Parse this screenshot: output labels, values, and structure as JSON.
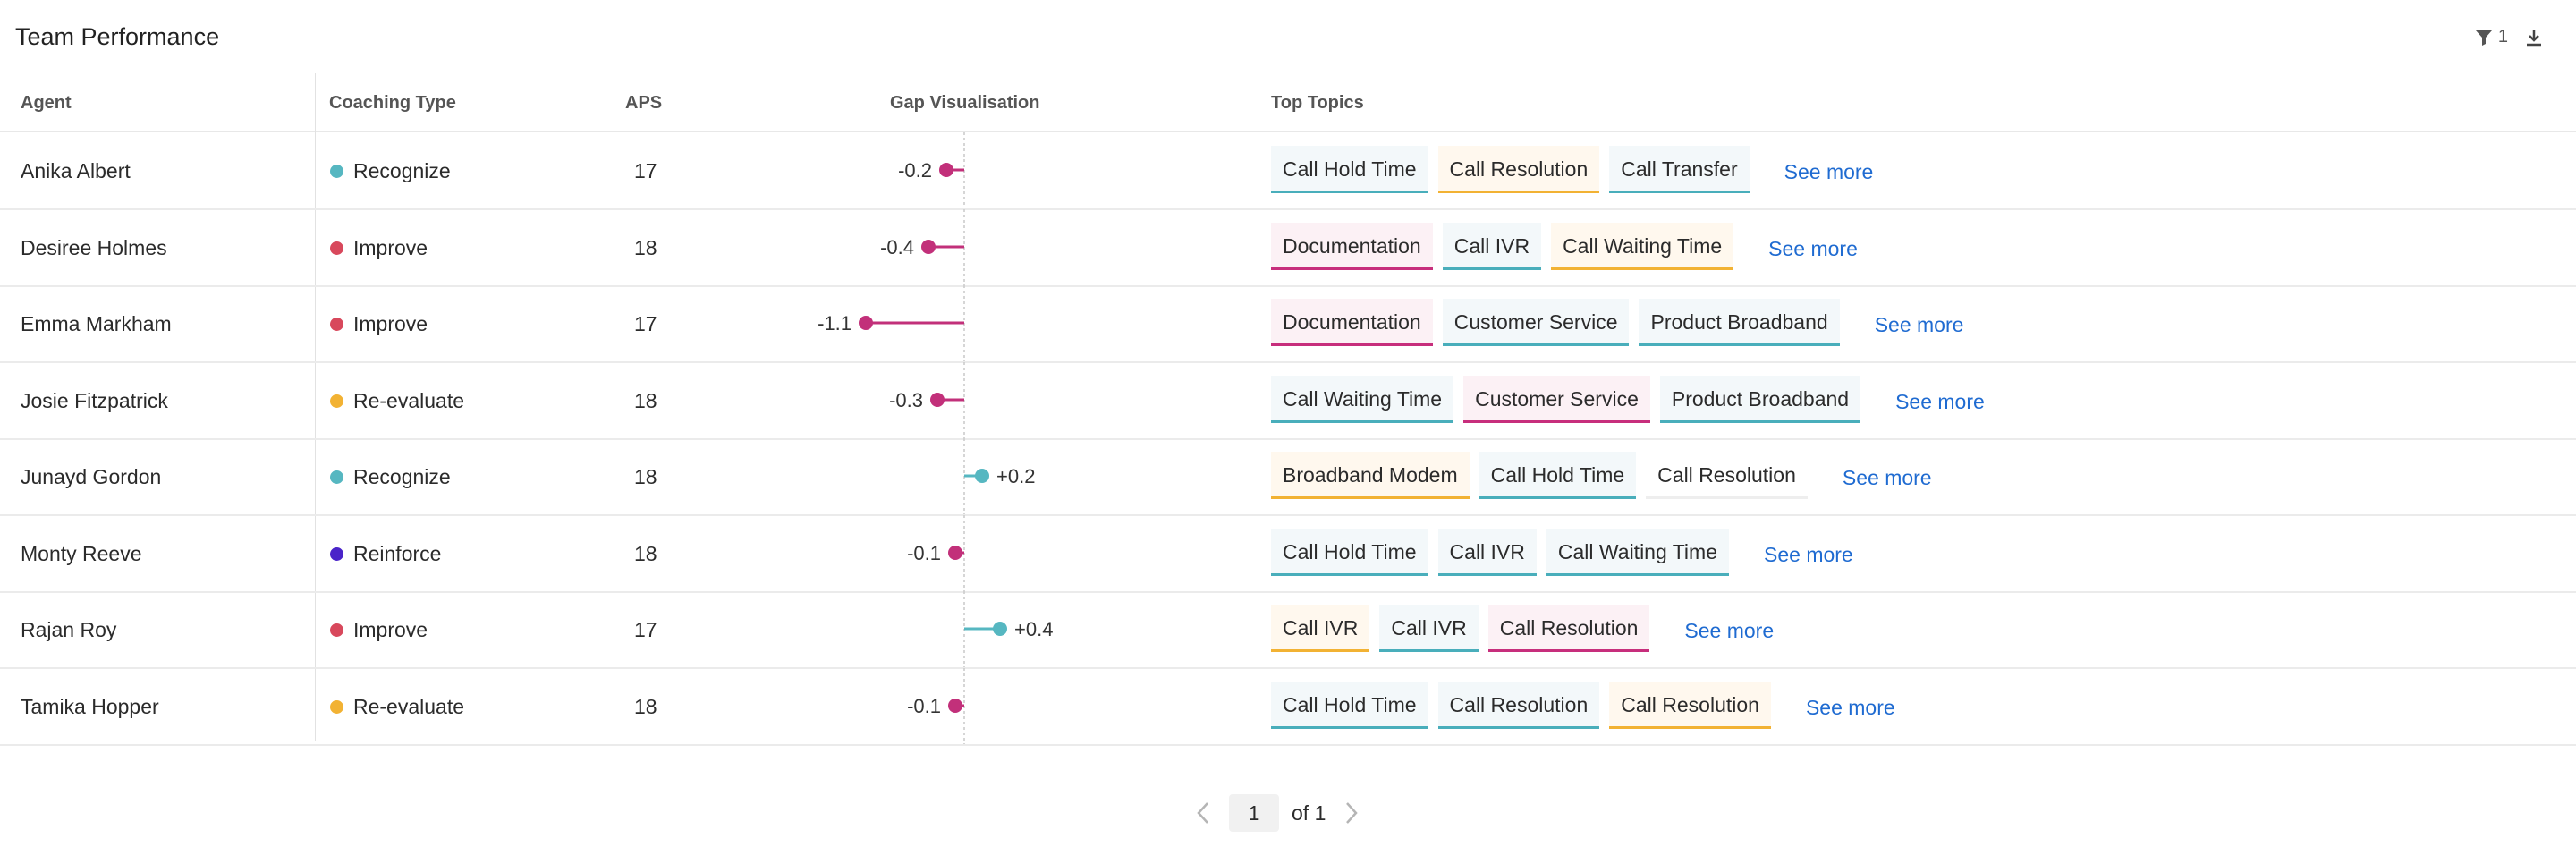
{
  "header": {
    "title": "Team Performance",
    "filter_count": "1",
    "filter_icon": "filter-icon",
    "download_icon": "download-icon"
  },
  "columns": {
    "agent": "Agent",
    "coaching_type": "Coaching Type",
    "aps": "APS",
    "gap": "Gap Visualisation",
    "topics": "Top Topics"
  },
  "coaching_colors": {
    "Recognize": "#56b7c1",
    "Improve": "#d8485c",
    "Re-evaluate": "#f2b233",
    "Reinforce": "#4a24c9"
  },
  "topic_colors": {
    "teal": {
      "border": "#49aebb",
      "bg": "#f3f8fa"
    },
    "orange": {
      "border": "#f2b233",
      "bg": "#fff8ee"
    },
    "pink": {
      "border": "#c72e7c",
      "bg": "#fcf1f5"
    },
    "none": {
      "border": "#eeeeee",
      "bg": "#ffffff"
    }
  },
  "gap_colors": {
    "negative": "#c2307a",
    "positive": "#56b7c1"
  },
  "rows": [
    {
      "agent": "Anika Albert",
      "coaching": "Recognize",
      "aps": "17",
      "gap": -0.2,
      "gap_label": "-0.2",
      "topics": [
        {
          "label": "Call Hold Time",
          "tone": "teal"
        },
        {
          "label": "Call Resolution",
          "tone": "orange"
        },
        {
          "label": "Call Transfer",
          "tone": "teal"
        }
      ],
      "see_more": "See more"
    },
    {
      "agent": "Desiree Holmes",
      "coaching": "Improve",
      "aps": "18",
      "gap": -0.4,
      "gap_label": "-0.4",
      "topics": [
        {
          "label": "Documentation",
          "tone": "pink"
        },
        {
          "label": "Call IVR",
          "tone": "teal"
        },
        {
          "label": "Call Waiting Time",
          "tone": "orange"
        }
      ],
      "see_more": "See more"
    },
    {
      "agent": "Emma Markham",
      "coaching": "Improve",
      "aps": "17",
      "gap": -1.1,
      "gap_label": "-1.1",
      "topics": [
        {
          "label": "Documentation",
          "tone": "pink"
        },
        {
          "label": "Customer Service",
          "tone": "teal"
        },
        {
          "label": "Product Broadband",
          "tone": "teal"
        }
      ],
      "see_more": "See more"
    },
    {
      "agent": "Josie Fitzpatrick",
      "coaching": "Re-evaluate",
      "aps": "18",
      "gap": -0.3,
      "gap_label": "-0.3",
      "topics": [
        {
          "label": "Call Waiting Time",
          "tone": "teal"
        },
        {
          "label": "Customer Service",
          "tone": "pink"
        },
        {
          "label": "Product Broadband",
          "tone": "teal"
        }
      ],
      "see_more": "See more"
    },
    {
      "agent": "Junayd Gordon",
      "coaching": "Recognize",
      "aps": "18",
      "gap": 0.2,
      "gap_label": "+0.2",
      "topics": [
        {
          "label": "Broadband Modem",
          "tone": "orange"
        },
        {
          "label": "Call Hold Time",
          "tone": "teal"
        },
        {
          "label": "Call Resolution",
          "tone": "none"
        }
      ],
      "see_more": "See more"
    },
    {
      "agent": "Monty Reeve",
      "coaching": "Reinforce",
      "aps": "18",
      "gap": -0.1,
      "gap_label": "-0.1",
      "topics": [
        {
          "label": "Call Hold Time",
          "tone": "teal"
        },
        {
          "label": "Call IVR",
          "tone": "teal"
        },
        {
          "label": "Call Waiting Time",
          "tone": "teal"
        }
      ],
      "see_more": "See more"
    },
    {
      "agent": "Rajan Roy",
      "coaching": "Improve",
      "aps": "17",
      "gap": 0.4,
      "gap_label": "+0.4",
      "topics": [
        {
          "label": "Call IVR",
          "tone": "orange"
        },
        {
          "label": "Call IVR",
          "tone": "teal"
        },
        {
          "label": "Call Resolution",
          "tone": "pink"
        }
      ],
      "see_more": "See more"
    },
    {
      "agent": "Tamika Hopper",
      "coaching": "Re-evaluate",
      "aps": "18",
      "gap": -0.1,
      "gap_label": "-0.1",
      "topics": [
        {
          "label": "Call Hold Time",
          "tone": "teal"
        },
        {
          "label": "Call Resolution",
          "tone": "teal"
        },
        {
          "label": "Call Resolution",
          "tone": "orange"
        }
      ],
      "see_more": "See more"
    }
  ],
  "pagination": {
    "current": "1",
    "of_label": "of 1",
    "prev_icon": "chevron-left-icon",
    "next_icon": "chevron-right-icon"
  }
}
